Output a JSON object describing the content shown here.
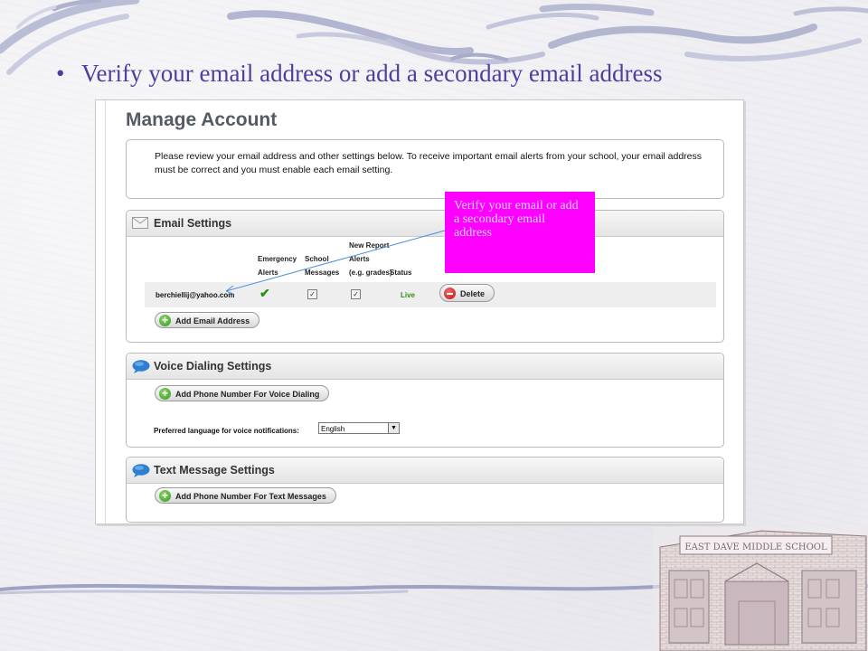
{
  "slide": {
    "bullet_text": "Verify your email address or add a secondary email address",
    "callout_text": "Verify your email or add a secondary email address"
  },
  "screenshot": {
    "page_title": "Manage Account",
    "notice": "Please review your email address and other settings below. To receive important email alerts from your school, your email address must be correct and you must enable each email setting.",
    "email_settings": {
      "title": "Email Settings",
      "columns": {
        "emergency_alerts": [
          "Emergency",
          "Alerts"
        ],
        "school_messages": [
          "School",
          "Messages"
        ],
        "new_report_alerts": [
          "New Report",
          "Alerts",
          "(e.g. grades)"
        ],
        "status": "Status"
      },
      "rows": [
        {
          "email": "berchiellij@yahoo.com",
          "emergency_alerts": true,
          "school_messages": true,
          "new_report_alerts": true,
          "status": "Live",
          "delete_label": "Delete"
        }
      ],
      "add_button": "Add Email Address"
    },
    "voice_settings": {
      "title": "Voice Dialing Settings",
      "add_button": "Add Phone Number For Voice Dialing",
      "language_label": "Preferred language for voice notifications:",
      "language_value": "English"
    },
    "text_settings": {
      "title": "Text Message Settings",
      "add_button": "Add Phone Number For Text Messages"
    }
  },
  "school_image": {
    "sign_text": "EAST DAVE MIDDLE SCHOOL"
  },
  "colors": {
    "bullet_text": "#4c3f9d",
    "callout_bg": "#ff00ff",
    "status_live": "#2e8f13"
  }
}
